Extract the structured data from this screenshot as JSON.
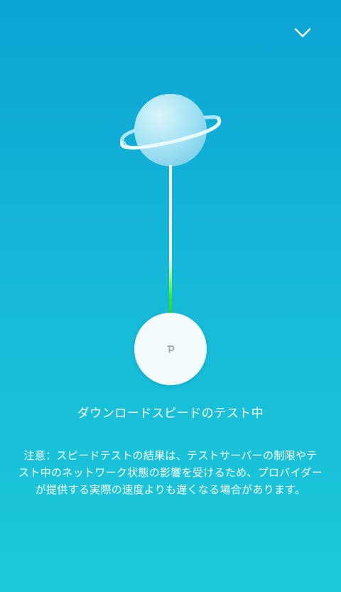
{
  "header": {
    "collapse_icon": "chevron-down-icon"
  },
  "illustration": {
    "planet_icon": "planet-icon",
    "router_icon": "tp-link-logo-icon",
    "colors": {
      "connector_progress": "#22d51f",
      "background_top": "#0ba3d3",
      "background_bottom": "#1dc9d9"
    }
  },
  "status": {
    "text": "ダウンロードスピードのテスト中"
  },
  "notice": {
    "text": "注意：スピードテストの結果は、テストサーバーの制限やテスト中のネットワーク状態の影響を受けるため、プロバイダーが提供する実際の速度よりも遅くなる場合があります。"
  }
}
